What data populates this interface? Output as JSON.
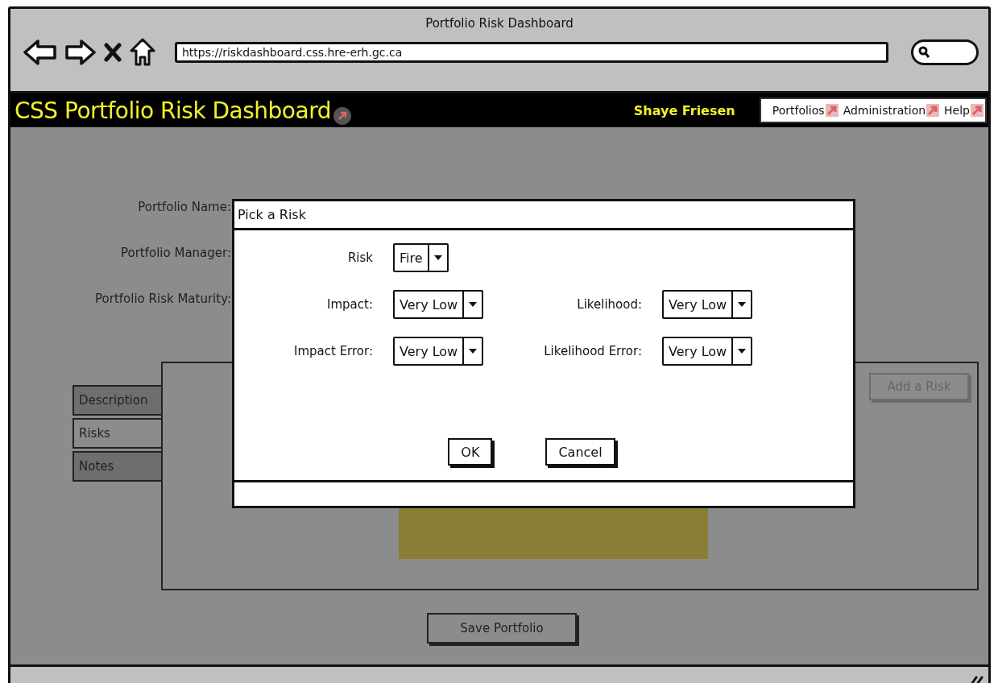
{
  "window": {
    "title": "Portfolio Risk Dashboard"
  },
  "browser": {
    "url": "https://riskdashboard.css.hre-erh.gc.ca"
  },
  "header": {
    "title": "CSS Portfolio Risk Dashboard",
    "user": "Shaye Friesen",
    "nav": [
      {
        "label": "Portfolios"
      },
      {
        "label": "Administration"
      },
      {
        "label": "Help"
      }
    ]
  },
  "form": {
    "fields": [
      {
        "label": "Portfolio Name:"
      },
      {
        "label": "Portfolio Manager:"
      },
      {
        "label": "Portfolio Risk Maturity:"
      }
    ]
  },
  "tabs": [
    {
      "label": "Description",
      "selected": false
    },
    {
      "label": "Risks",
      "selected": true
    },
    {
      "label": "Notes",
      "selected": false
    }
  ],
  "add_button": {
    "label": "Add a Risk",
    "disabled": true
  },
  "save_button": {
    "label": "Save Portfolio"
  },
  "dialog": {
    "title": "Pick a Risk",
    "rows": [
      {
        "fields": [
          {
            "label": "Risk",
            "value": "Fire"
          }
        ]
      },
      {
        "fields": [
          {
            "label": "Impact:",
            "value": "Very Low"
          },
          {
            "label": "Likelihood:",
            "value": "Very Low"
          }
        ]
      },
      {
        "fields": [
          {
            "label": "Impact Error:",
            "value": "Very Low"
          },
          {
            "label": "Likelihood Error:",
            "value": "Very Low"
          }
        ]
      }
    ],
    "buttons": [
      {
        "label": "OK"
      },
      {
        "label": "Cancel"
      }
    ]
  }
}
